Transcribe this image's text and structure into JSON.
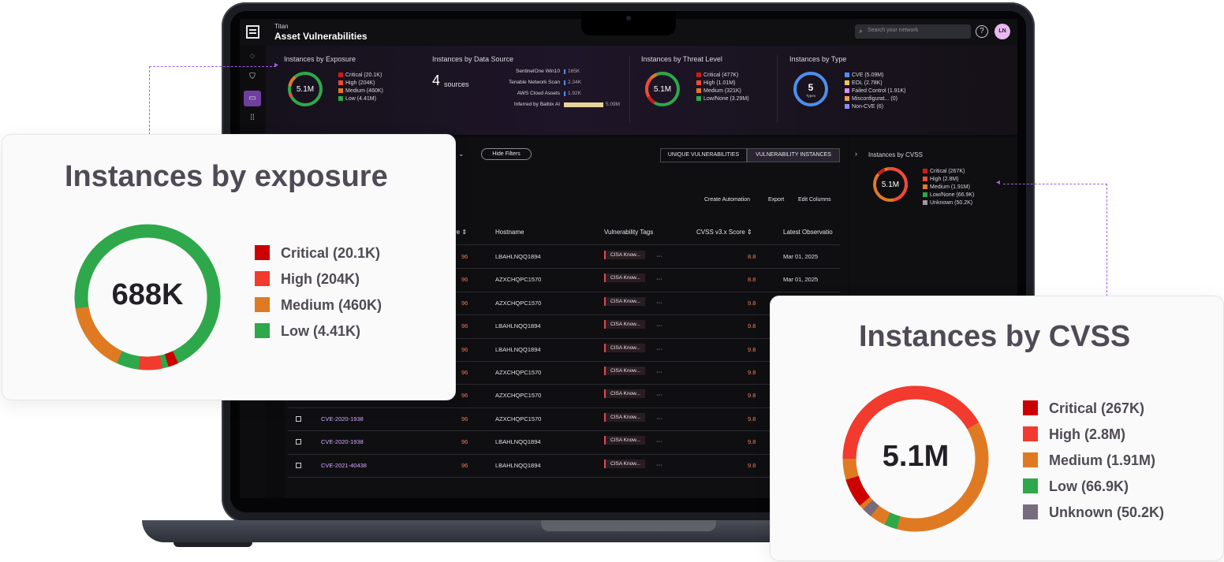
{
  "app": {
    "subtitle": "Titan",
    "title": "Asset Vulnerabilities"
  },
  "search": {
    "placeholder": "Search your network"
  },
  "help": "?",
  "user_initials": "LN",
  "stats": {
    "exposure": {
      "title": "Instances by Exposure",
      "center": "5.1M",
      "legend": [
        {
          "label": "Critical (20.1K)",
          "color": "#d21a1a"
        },
        {
          "label": "High (204K)",
          "color": "#f04a3a"
        },
        {
          "label": "Medium (460K)",
          "color": "#e07a25"
        },
        {
          "label": "Low (4.41M)",
          "color": "#2fa84a"
        }
      ]
    },
    "data_source": {
      "title": "Instances by Data Source",
      "count": "4",
      "count_label": "sources",
      "rows": [
        {
          "label": "SentinelOne Win10",
          "value": "165K"
        },
        {
          "label": "Tenable Network Scan",
          "value": "2.34K"
        },
        {
          "label": "AWS Cloud Assets",
          "value": "1.92K"
        },
        {
          "label": "Inferred by Balbix AI",
          "value": "5.09M"
        }
      ]
    },
    "threat": {
      "title": "Instances by Threat Level",
      "center": "5.1M",
      "legend": [
        {
          "label": "Critical (477K)",
          "color": "#d21a1a"
        },
        {
          "label": "High (1.01M)",
          "color": "#f04a3a"
        },
        {
          "label": "Medium (321K)",
          "color": "#e07a25"
        },
        {
          "label": "Low/None (3.29M)",
          "color": "#2fa84a"
        }
      ]
    },
    "type": {
      "title": "Instances by Type",
      "center": "5",
      "center_sub": "Types",
      "legend": [
        {
          "label": "CVE (5.09M)",
          "color": "#4d8ff0"
        },
        {
          "label": "EOL (2.78K)",
          "color": "#f0c64d"
        },
        {
          "label": "Failed Control (1.91K)",
          "color": "#d98ff0"
        },
        {
          "label": "Misconfigurat... (0)",
          "color": "#f0a04d"
        },
        {
          "label": "Non-CVE (6)",
          "color": "#8c8cf0"
        }
      ]
    }
  },
  "toolbar": {
    "hide_filters": "Hide Filters",
    "tab_unique": "UNIQUE VULNERABILITIES",
    "tab_instances": "VULNERABILITY INSTANCES",
    "create_automation": "Create Automation",
    "export": "Export",
    "edit_columns": "Edit Columns"
  },
  "table": {
    "headers": {
      "score": "re",
      "hostname": "Hostname",
      "tags": "Vulnerability Tags",
      "cvss": "CVSS v3.x Score",
      "latest": "Latest Observatio"
    },
    "rows": [
      {
        "cve": "",
        "score": "96",
        "host": "LBAHLNQQ1894",
        "tag": "CISA Know...",
        "more": "···",
        "cvss": "8.8",
        "date": "Mar 01, 2025"
      },
      {
        "cve": "",
        "score": "96",
        "host": "AZXCHQPC1570",
        "tag": "CISA Know...",
        "more": "···",
        "cvss": "8.8",
        "date": "Mar 01, 2025"
      },
      {
        "cve": "",
        "score": "96",
        "host": "AZXCHQPC1570",
        "tag": "CISA Know...",
        "more": "···",
        "cvss": "9.8",
        "date": ""
      },
      {
        "cve": "",
        "score": "96",
        "host": "LBAHLNQQ1894",
        "tag": "CISA Know...",
        "more": "···",
        "cvss": "9.8",
        "date": ""
      },
      {
        "cve": "",
        "score": "96",
        "host": "LBAHLNQQ1894",
        "tag": "CISA Know...",
        "more": "···",
        "cvss": "9.8",
        "date": ""
      },
      {
        "cve": "",
        "score": "96",
        "host": "AZXCHQPC1570",
        "tag": "CISA Know...",
        "more": "···",
        "cvss": "9.8",
        "date": ""
      },
      {
        "cve": "",
        "score": "96",
        "host": "AZXCHQPC1570",
        "tag": "CISA Know...",
        "more": "···",
        "cvss": "9.8",
        "date": ""
      },
      {
        "cve": "CVE-2020-1938",
        "score": "96",
        "host": "AZXCHQPC1570",
        "tag": "CISA Know...",
        "more": "···",
        "cvss": "9.8",
        "date": ""
      },
      {
        "cve": "CVE-2020-1938",
        "score": "96",
        "host": "LBAHLNQQ1894",
        "tag": "CISA Know...",
        "more": "···",
        "cvss": "9.8",
        "date": ""
      },
      {
        "cve": "CVE-2021-40438",
        "score": "96",
        "host": "LBAHLNQQ1894",
        "tag": "CISA Know...",
        "more": "···",
        "cvss": "9.8",
        "date": ""
      }
    ]
  },
  "cvss_side": {
    "title": "Instances by CVSS",
    "center": "5.1M",
    "legend": [
      {
        "label": "Critical (267K)",
        "color": "#d21a1a"
      },
      {
        "label": "High (2.8M)",
        "color": "#f04a3a"
      },
      {
        "label": "Medium (1.91M)",
        "color": "#e07a25"
      },
      {
        "label": "Low/None (66.9K)",
        "color": "#2fa84a"
      },
      {
        "label": "Unknown (50.2K)",
        "color": "#7a6e80"
      }
    ]
  },
  "callout_exposure": {
    "title": "Instances by exposure",
    "center": "688K",
    "legend": [
      {
        "label": "Critical (20.1K)",
        "color": "#cc0000"
      },
      {
        "label": "High (204K)",
        "color": "#f33a2e"
      },
      {
        "label": "Medium (460K)",
        "color": "#e07a22"
      },
      {
        "label": "Low (4.41K)",
        "color": "#2ea84a"
      }
    ]
  },
  "callout_cvss": {
    "title": "Instances by CVSS",
    "center": "5.1M",
    "legend": [
      {
        "label": "Critical (267K)",
        "color": "#cc0000"
      },
      {
        "label": "High (2.8M)",
        "color": "#f33a2e"
      },
      {
        "label": "Medium (1.91M)",
        "color": "#e07a22"
      },
      {
        "label": "Low (66.9K)",
        "color": "#2ea84a"
      },
      {
        "label": "Unknown (50.2K)",
        "color": "#776b7e"
      }
    ]
  }
}
